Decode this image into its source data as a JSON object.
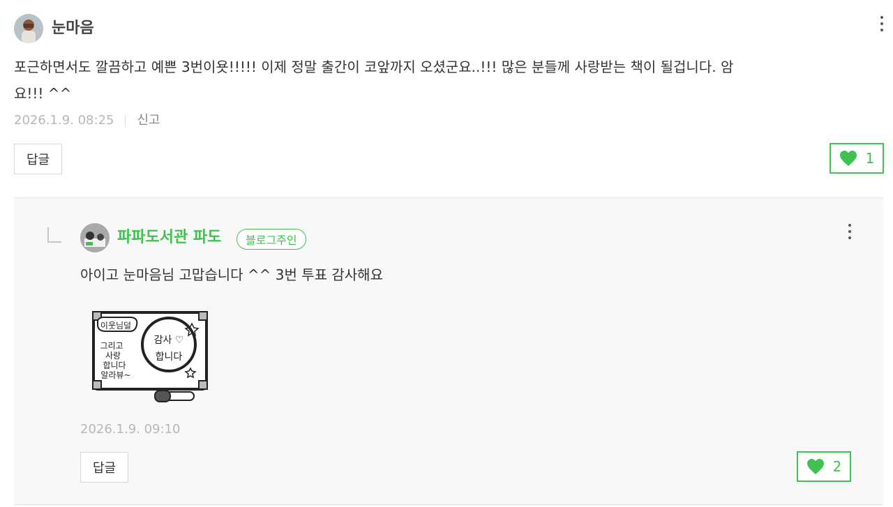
{
  "comment": {
    "author": "눈마음",
    "text": "포근하면서도 깔끔하고 예쁜 3번이욧!!!!! 이제 정말 출간이 코앞까지 오셨군요..!!! 많은 분들께 사랑받는 책이 될겁니다. 암요!!! ^^",
    "text_line1": "포근하면서도 깔끔하고 예쁜 3번이욧!!!!! 이제 정말 출간이 코앞까지 오셨군요..!!! 많은 분들께 사랑받는 책이 될겁니다. 암",
    "text_line2": "요!!! ^^",
    "timestamp": "2026.1.9. 08:25",
    "report_label": "신고",
    "reply_label": "답글",
    "like_count": "1"
  },
  "reply": {
    "author": "파파도서관 파도",
    "badge": "블로그주인",
    "text": "아이고 눈마음님 고맙습니다 ^^ 3번 투표 감사해요",
    "timestamp": "2026.1.9. 09:10",
    "reply_label": "답글",
    "like_count": "2",
    "sticker": {
      "left_text": [
        "이웃님덜",
        "그리고",
        "사랑",
        "합니다",
        "알라뷰~"
      ],
      "circle_text": [
        "감사 ♡",
        "합니다"
      ]
    }
  },
  "colors": {
    "accent_green": "#3fc24f",
    "text": "#333333",
    "muted": "#b7b7b7",
    "reply_bg": "#f8f8f8"
  },
  "icons": {
    "more": "more-vertical-icon",
    "like": "heart-icon",
    "reply_corner": "reply-corner-icon"
  }
}
